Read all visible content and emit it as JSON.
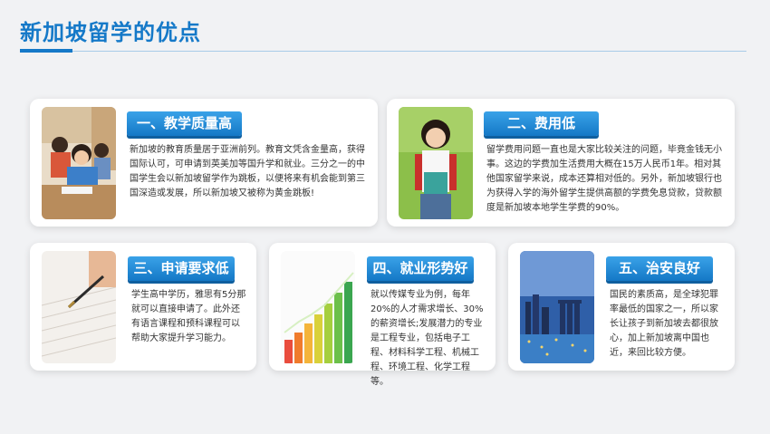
{
  "page": {
    "title": "新加坡留学的优点"
  },
  "cards": [
    {
      "heading": "一、教学质量高",
      "body": "新加坡的教育质量居于亚洲前列。教育文凭含金量高，获得国际认可，可申请到英美加等国升学和就业。三分之一的中国学生会以新加坡留学作为跳板，以便将来有机会能到第三国深造或发展，所以新加坡又被称为黄金跳板!"
    },
    {
      "heading": "二、费用低",
      "body": "留学费用问题一直也是大家比较关注的问题，毕竟金钱无小事。这边的学费加生活费用大概在15万人民币1年。相对其他国家留学来说，成本还算相对低的。另外，新加坡银行也为获得入学的海外留学生提供高额的学费免息贷款，贷款额度是新加坡本地学生学费的90%。"
    },
    {
      "heading": "三、申请要求低",
      "body": "学生高中学历，雅思有5分那就可以直接申请了。此外还有语言课程和预科课程可以帮助大家提升学习能力。"
    },
    {
      "heading": "四、就业形势好",
      "body": "就以传媒专业为例，每年20%的人才需求增长、30%的薪资增长;发展潜力的专业是工程专业，包括电子工程、材料科学工程、机械工程、环境工程、化学工程等。"
    },
    {
      "heading": "五、治安良好",
      "body": "国民的素质高，是全球犯罪率最低的国家之一，所以家长让孩子到新加坡去都很放心，加上新加坡离中国也近，来回比较方便。"
    }
  ],
  "colors": {
    "accent": "#1579c8",
    "background": "#f1f2f4",
    "card": "#ffffff"
  }
}
